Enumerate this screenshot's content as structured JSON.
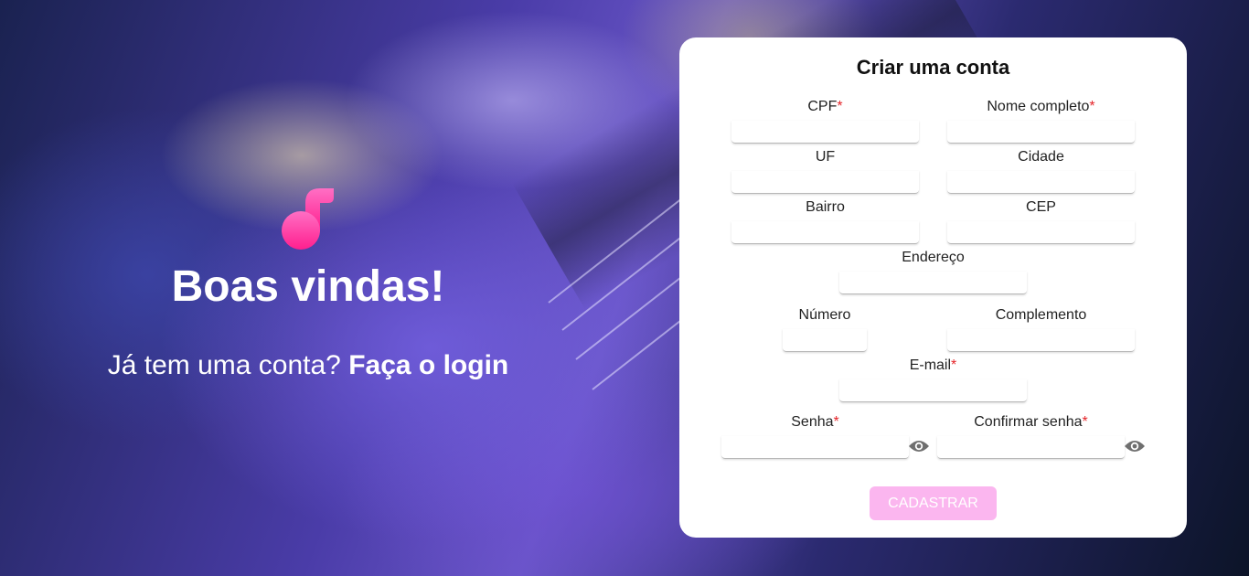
{
  "welcome": {
    "title": "Boas vindas!",
    "prompt": "Já tem uma conta?",
    "login_link": "Faça o login",
    "icon": "music-note-icon"
  },
  "form": {
    "title": "Criar uma conta",
    "required_mark": "*",
    "fields": {
      "cpf": {
        "label": "CPF",
        "value": ""
      },
      "nome": {
        "label": "Nome completo",
        "value": ""
      },
      "uf": {
        "label": "UF",
        "value": ""
      },
      "cidade": {
        "label": "Cidade",
        "value": ""
      },
      "bairro": {
        "label": "Bairro",
        "value": ""
      },
      "cep": {
        "label": "CEP",
        "value": ""
      },
      "endereco": {
        "label": "Endereço",
        "value": ""
      },
      "numero": {
        "label": "Número",
        "value": ""
      },
      "complemento": {
        "label": "Complemento",
        "value": ""
      },
      "email": {
        "label": "E-mail",
        "value": ""
      },
      "senha": {
        "label": "Senha",
        "value": ""
      },
      "confirmar": {
        "label": "Confirmar senha",
        "value": ""
      }
    },
    "submit_label": "CADASTRAR",
    "colors": {
      "required": "#e5252a",
      "button": "#fbb6ef",
      "accent": "#ff2ea0"
    }
  }
}
